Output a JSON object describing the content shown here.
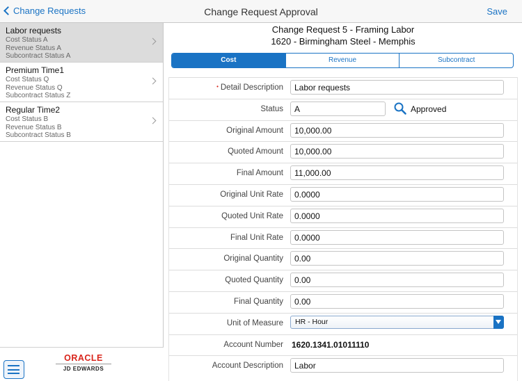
{
  "nav": {
    "back_label": "Change Requests",
    "title": "Change Request Approval",
    "save_label": "Save"
  },
  "sidebar": {
    "items": [
      {
        "name": "Labor requests",
        "line1": "Cost Status A",
        "line2": "Revenue Status A",
        "line3": "Subcontract Status A",
        "selected": true
      },
      {
        "name": "Premium Time1",
        "line1": "Cost Status Q",
        "line2": "Revenue Status Q",
        "line3": "Subcontract Status Z",
        "selected": false
      },
      {
        "name": "Regular Time2",
        "line1": "Cost Status B",
        "line2": "Revenue Status B",
        "line3": "Subcontract Status B",
        "selected": false
      }
    ],
    "logo_top": "ORACLE",
    "logo_bottom": "JD EDWARDS"
  },
  "header": {
    "line1": "Change Request 5 - Framing Labor",
    "line2": "1620 - Birmingham Steel - Memphis"
  },
  "tabs": [
    {
      "label": "Cost",
      "active": true
    },
    {
      "label": "Revenue",
      "active": false
    },
    {
      "label": "Subcontract",
      "active": false
    }
  ],
  "form": {
    "detail_description": {
      "label": "Detail Description",
      "value": "Labor requests",
      "required": true
    },
    "status": {
      "label": "Status",
      "value": "A",
      "description": "Approved"
    },
    "original_amount": {
      "label": "Original Amount",
      "value": "10,000.00"
    },
    "quoted_amount": {
      "label": "Quoted Amount",
      "value": "10,000.00"
    },
    "final_amount": {
      "label": "Final Amount",
      "value": "11,000.00"
    },
    "original_unit_rate": {
      "label": "Original Unit Rate",
      "value": "0.0000"
    },
    "quoted_unit_rate": {
      "label": "Quoted Unit Rate",
      "value": "0.0000"
    },
    "final_unit_rate": {
      "label": "Final Unit Rate",
      "value": "0.0000"
    },
    "original_quantity": {
      "label": "Original Quantity",
      "value": "0.00"
    },
    "quoted_quantity": {
      "label": "Quoted Quantity",
      "value": "0.00"
    },
    "final_quantity": {
      "label": "Final Quantity",
      "value": "0.00"
    },
    "unit_of_measure": {
      "label": "Unit of Measure",
      "value": "HR - Hour"
    },
    "account_number": {
      "label": "Account Number",
      "value": "1620.1341.01011110"
    },
    "account_description": {
      "label": "Account Description",
      "value": "Labor"
    }
  },
  "colors": {
    "accent": "#1a73c4",
    "selected_row": "#dcdcdc",
    "required": "#d9261c",
    "oracle_red": "#d9261c"
  },
  "icons": {
    "back": "chevron-left-icon",
    "row_arrow": "chevron-right-icon",
    "search": "search-icon",
    "menu": "hamburger-menu-icon",
    "dropdown": "dropdown-arrow-icon"
  }
}
